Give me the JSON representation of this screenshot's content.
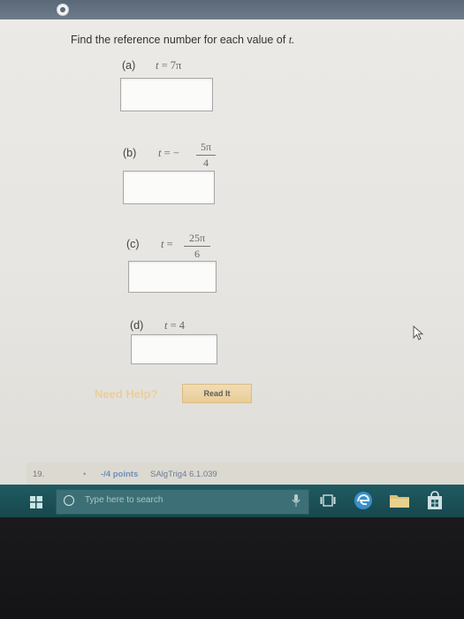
{
  "question": {
    "title": "Find the reference number for each value of",
    "title_var": "t."
  },
  "parts": [
    {
      "label": "(a)",
      "lhs": "t",
      "expr": "= 7π"
    },
    {
      "label": "(b)",
      "lhs": "t",
      "eq": "= −",
      "numerator": "5π",
      "denominator": "4"
    },
    {
      "label": "(c)",
      "lhs": "t",
      "eq": "=",
      "numerator": "25π",
      "denominator": "6"
    },
    {
      "label": "(d)",
      "lhs": "t",
      "expr": "= 4"
    }
  ],
  "help": {
    "need_help": "Need Help?",
    "read_it": "Read It"
  },
  "next_question": {
    "number": "19.",
    "dot": "•",
    "points": "-/4 points",
    "source": "SAlgTrig4 6.1.039"
  },
  "taskbar": {
    "search_placeholder": "Type here to search"
  },
  "colors": {
    "taskbar": "#1f5b62",
    "read_it_button": "#e9cd97",
    "need_help_text": "#e8cf9d",
    "points_text": "#6d8fb8"
  },
  "icons": [
    "windows-start-icon",
    "search-icon",
    "microphone-icon",
    "task-view-icon",
    "edge-browser-icon",
    "file-explorer-icon",
    "store-icon",
    "mouse-cursor-icon"
  ]
}
